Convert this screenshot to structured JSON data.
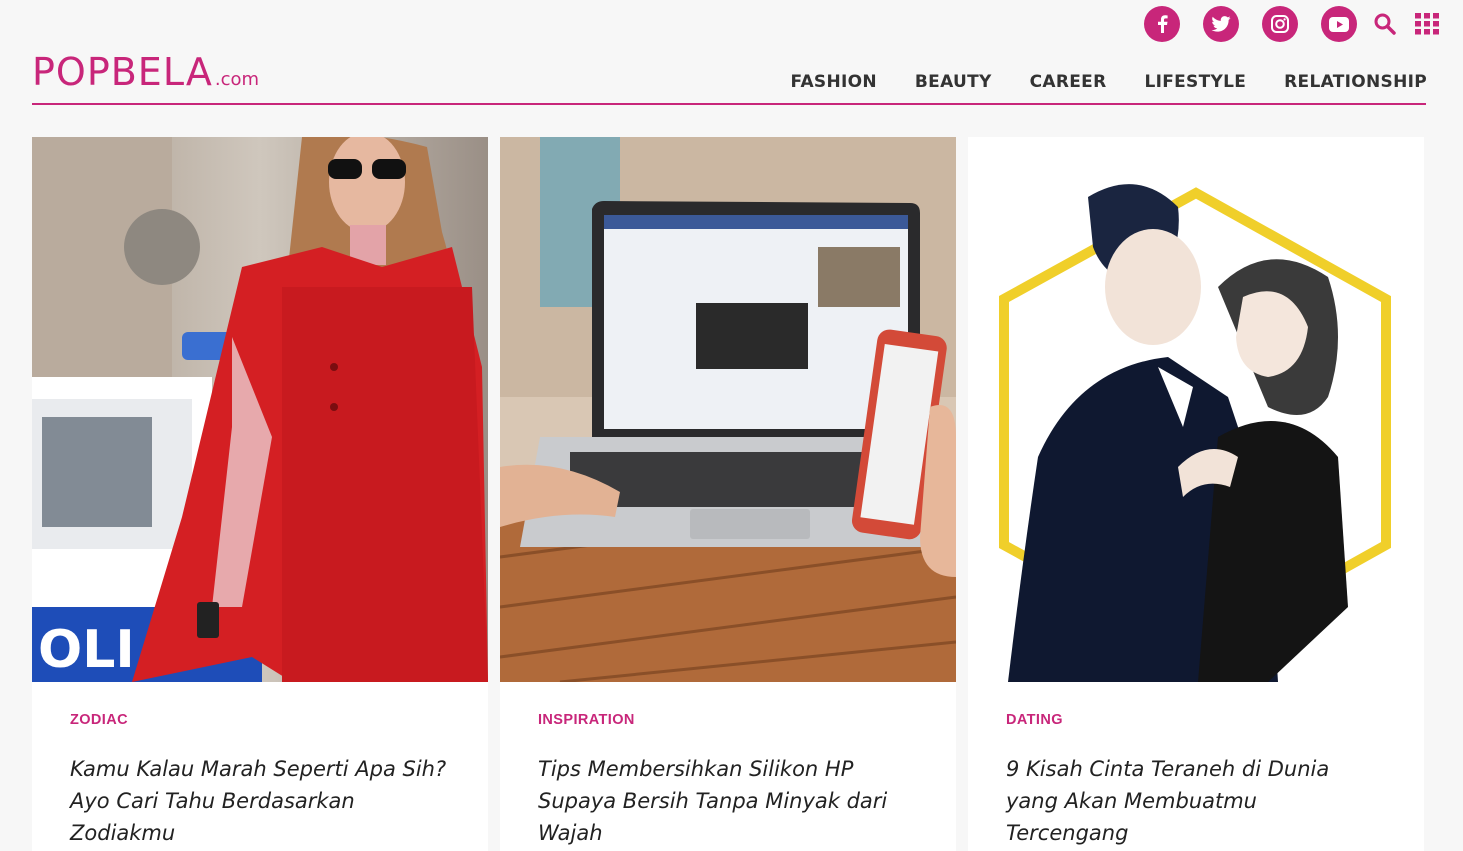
{
  "brand": {
    "logo_main": "POPBELA",
    "logo_suffix": ".com",
    "accent_color": "#c8267a"
  },
  "social": [
    {
      "name": "facebook",
      "icon": "facebook-icon"
    },
    {
      "name": "twitter",
      "icon": "twitter-icon"
    },
    {
      "name": "instagram",
      "icon": "instagram-icon"
    },
    {
      "name": "youtube",
      "icon": "youtube-icon"
    }
  ],
  "utility": [
    {
      "name": "search",
      "icon": "search-icon"
    },
    {
      "name": "menu",
      "icon": "grid-menu-icon"
    }
  ],
  "nav": {
    "items": [
      {
        "label": "FASHION"
      },
      {
        "label": "BEAUTY"
      },
      {
        "label": "CAREER"
      },
      {
        "label": "LIFESTYLE"
      },
      {
        "label": "RELATIONSHIP"
      }
    ]
  },
  "cards": [
    {
      "category": "ZODIAC",
      "title": "Kamu Kalau Marah Seperti Apa Sih? Ayo Cari Tahu Berdasarkan Zodiakmu"
    },
    {
      "category": "INSPIRATION",
      "title": "Tips Membersihkan Silikon HP Supaya Bersih Tanpa Minyak dari Wajah"
    },
    {
      "category": "DATING",
      "title": "9 Kisah Cinta Teraneh di Dunia yang Akan Membuatmu Tercengang"
    }
  ]
}
